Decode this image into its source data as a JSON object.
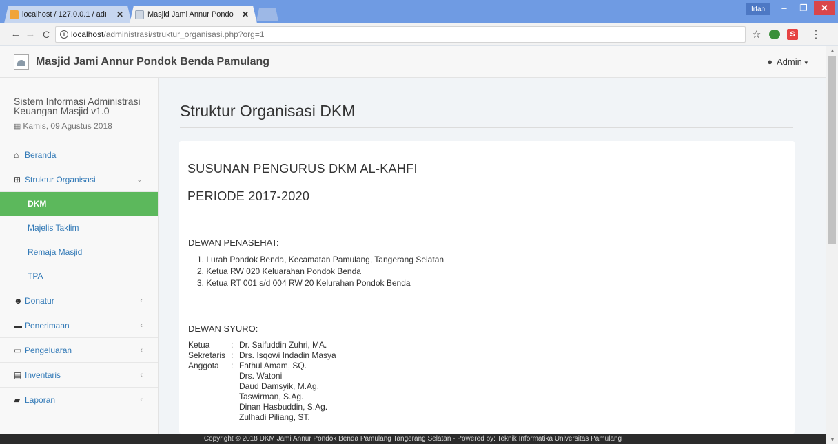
{
  "browser": {
    "tabs": [
      {
        "title": "localhost / 127.0.0.1 / adı",
        "active": false
      },
      {
        "title": "Masjid Jami Annur Pondo",
        "active": true
      }
    ],
    "close_glyph": "✕",
    "window_user": "Irfan",
    "window_controls": {
      "minimize": "–",
      "maximize": "❐",
      "close": "✕"
    },
    "url_host": "localhost",
    "url_path": "/administrasi/struktur_organisasi.php?org=1",
    "info_glyph": "i",
    "ext_badge": "S",
    "glyphs": {
      "back": "←",
      "forward": "→",
      "reload": "C",
      "star": "☆",
      "menu": "⋮"
    }
  },
  "navbar": {
    "brand": "Masjid Jami Annur Pondok Benda Pamulang",
    "user_label": "Admin",
    "user_caret": "▾"
  },
  "sidebar": {
    "system_title": "Sistem Informasi Administrasi Keuangan Masjid v1.0",
    "date": "Kamis, 09 Agustus 2018",
    "menu": [
      {
        "label": "Beranda",
        "icon": "home-icon",
        "glyph": "⌂"
      },
      {
        "label": "Struktur Organisasi",
        "icon": "sitemap-icon",
        "glyph": "⊞",
        "expanded": true
      },
      {
        "label": "Donatur",
        "icon": "users-icon",
        "glyph": "☻"
      },
      {
        "label": "Penerimaan",
        "icon": "folder-icon",
        "glyph": "▬"
      },
      {
        "label": "Pengeluaran",
        "icon": "folder-open-icon",
        "glyph": "▭"
      },
      {
        "label": "Inventaris",
        "icon": "archive-icon",
        "glyph": "▤"
      },
      {
        "label": "Laporan",
        "icon": "book-icon",
        "glyph": "▰"
      }
    ],
    "submenu": [
      {
        "label": "DKM",
        "active": true
      },
      {
        "label": "Majelis Taklim",
        "active": false
      },
      {
        "label": "Remaja Masjid",
        "active": false
      },
      {
        "label": "TPA",
        "active": false
      }
    ],
    "arrow_collapsed": "‹",
    "arrow_expanded": "⌄"
  },
  "main": {
    "page_title": "Struktur Organisasi DKM",
    "heading_1": "SUSUNAN PENGURUS DKM AL-KAHFI",
    "heading_2": "PERIODE 2017-2020",
    "dewan_penasehat": {
      "title": "DEWAN PENASEHAT:",
      "items": [
        "1. Lurah Pondok Benda, Kecamatan Pamulang, Tangerang Selatan",
        "2. Ketua RW 020 Keluarahan Pondok Benda",
        "3. Ketua RT 001 s/d 004 RW 20 Kelurahan Pondok Benda"
      ]
    },
    "dewan_syuro": {
      "title": "DEWAN SYURO:",
      "rows": [
        {
          "label": "Ketua",
          "colon": ":",
          "value": "Dr. Saifuddin Zuhri, MA."
        },
        {
          "label": "Sekretaris",
          "colon": ":",
          "value": "Drs. Isqowi Indadin Masya"
        },
        {
          "label": "Anggota",
          "colon": ":",
          "value": "Fathul Amam, SQ."
        },
        {
          "label": "",
          "colon": "",
          "value": "Drs. Watoni"
        },
        {
          "label": "",
          "colon": "",
          "value": "Daud Damsyik, M.Ag."
        },
        {
          "label": "",
          "colon": "",
          "value": "Taswirman, S.Ag."
        },
        {
          "label": "",
          "colon": "",
          "value": "Dinan Hasbuddin, S.Ag."
        },
        {
          "label": "",
          "colon": "",
          "value": "Zulhadi Piliang, ST."
        }
      ]
    }
  },
  "footer": {
    "text": "Copyright © 2018 DKM Jami Annur Pondok Benda Pamulang Tangerang Selatan - Powered by: Teknik Informatika Universitas Pamulang"
  },
  "colors": {
    "titlebar": "#6f9be3",
    "active_menu": "#5cb85c",
    "link": "#337ab7",
    "footer": "#2b2b2b"
  }
}
